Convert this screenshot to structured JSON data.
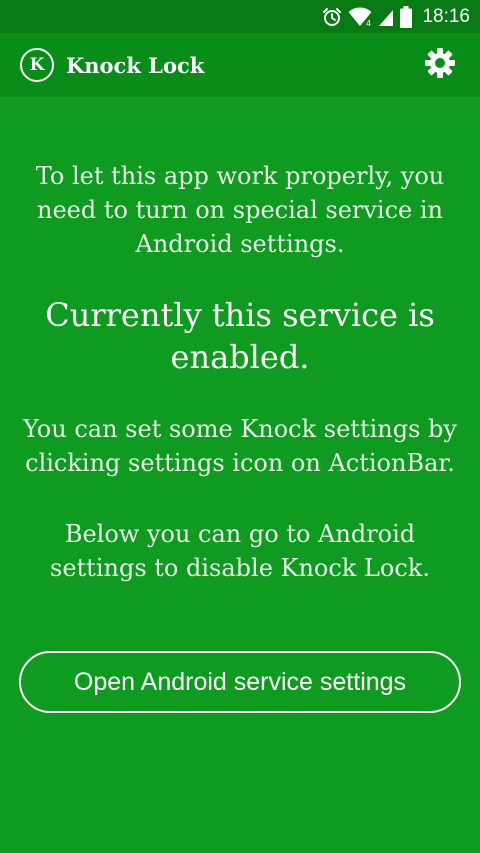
{
  "status_bar": {
    "time": "18:16",
    "icons": [
      "alarm-icon",
      "wifi-icon",
      "signal-icon",
      "battery-icon"
    ]
  },
  "action_bar": {
    "logo_letter": "K",
    "title": "Knock Lock",
    "settings_icon": "gear-icon"
  },
  "content": {
    "paragraph1": "To let this app work properly, you need to turn on special service in Android settings.",
    "headline": "Currently this service is enabled.",
    "paragraph2": "You can set some Knock settings by clicking settings icon on ActionBar.",
    "paragraph3": "Below you can go to Android settings to disable Knock Lock."
  },
  "button": {
    "label": "Open Android service settings"
  },
  "colors": {
    "background": "#0f9a20",
    "action_bar": "#078d18",
    "status_bar": "#077a14",
    "text": "#ffffff"
  }
}
